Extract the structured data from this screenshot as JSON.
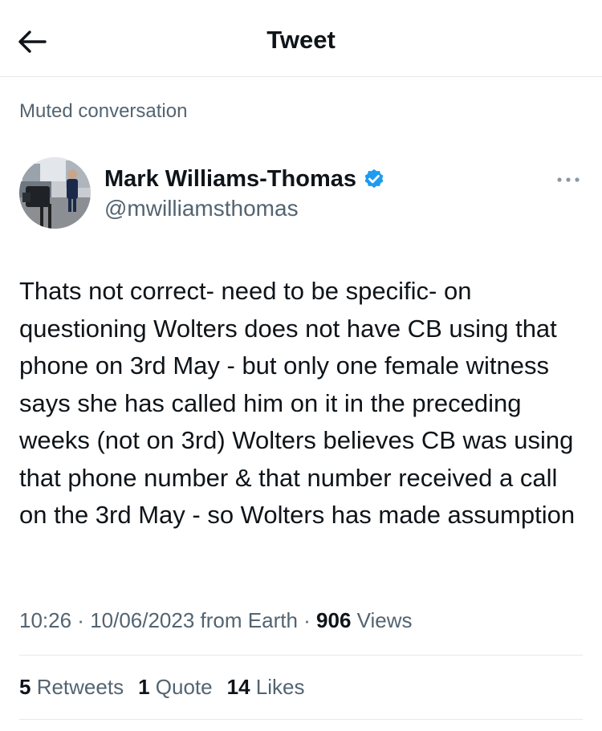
{
  "header": {
    "title": "Tweet"
  },
  "muted_label": "Muted conversation",
  "author": {
    "name": "Mark Williams-Thomas",
    "handle": "@mwilliamsthomas",
    "verified": true
  },
  "tweet": {
    "text": "Thats not correct- need to be specific- on questioning Wolters does not have CB using that phone on 3rd May - but only one female witness says she has called him on it in the preceding weeks (not on 3rd) Wolters believes CB was using that phone number & that number received a call on the 3rd May - so Wolters has made assumption"
  },
  "meta": {
    "time": "10:26",
    "sep1": " · ",
    "date": "10/06/2023",
    "source": " from Earth",
    "sep2": " · ",
    "views_count": "906",
    "views_label": " Views"
  },
  "stats": {
    "retweets_count": "5",
    "retweets_label": " Retweets",
    "quotes_count": "1",
    "quotes_label": " Quote",
    "likes_count": "14",
    "likes_label": " Likes"
  },
  "colors": {
    "text": "#0f1419",
    "secondary": "#536471",
    "verified": "#1d9bf0",
    "divider": "#e7e9ea"
  },
  "icons": {
    "back": "arrow-left-icon",
    "verified": "verified-badge-icon",
    "more": "more-horizontal-icon"
  }
}
